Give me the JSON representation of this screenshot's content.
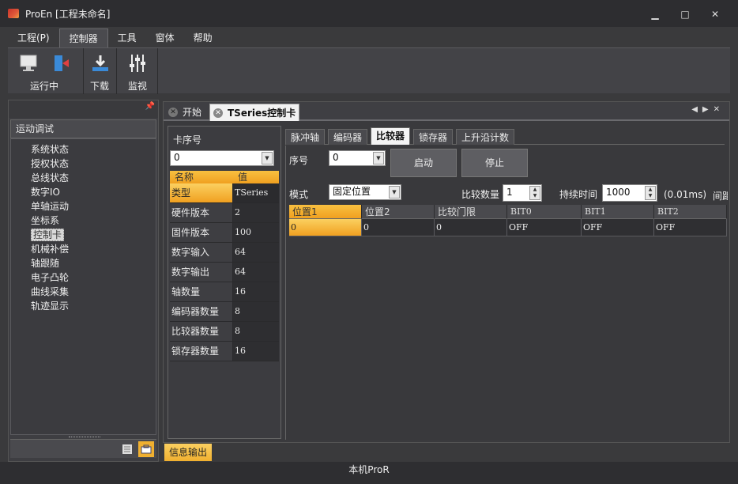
{
  "window": {
    "title": "ProEn [工程未命名]"
  },
  "menu": {
    "items": [
      "工程(P)",
      "控制器",
      "工具",
      "窗体",
      "帮助"
    ]
  },
  "ribbon": {
    "run_label": "运行中",
    "download_label": "下载",
    "monitor_label": "监视"
  },
  "left_panel": {
    "title": "运动调试",
    "items": [
      "系统状态",
      "授权状态",
      "总线状态",
      "数字IO",
      "单轴运动",
      "坐标系",
      "控制卡",
      "机械补偿",
      "轴跟随",
      "电子凸轮",
      "曲线采集",
      "轨迹显示"
    ],
    "selected": "控制卡"
  },
  "doc_tabs": {
    "start": "开始",
    "card": "TSeries控制卡"
  },
  "card": {
    "label": "卡序号",
    "index_value": "0",
    "head_name": "名称",
    "head_value": "值",
    "rows": [
      {
        "k": "类型",
        "v": "TSeries"
      },
      {
        "k": "硬件版本",
        "v": "2"
      },
      {
        "k": "固件版本",
        "v": "100"
      },
      {
        "k": "数字输入",
        "v": "64"
      },
      {
        "k": "数字输出",
        "v": "64"
      },
      {
        "k": "轴数量",
        "v": "16"
      },
      {
        "k": "编码器数量",
        "v": "8"
      },
      {
        "k": "比较器数量",
        "v": "8"
      },
      {
        "k": "锁存器数量",
        "v": "16"
      }
    ]
  },
  "sub_tabs": [
    "脉冲轴",
    "编码器",
    "比较器",
    "锁存器",
    "上升沿计数"
  ],
  "comparator": {
    "index_label": "序号",
    "index_value": "0",
    "start_button": "启动",
    "stop_button": "停止",
    "mode_label": "模式",
    "mode_value": "固定位置",
    "count_label": "比较数量",
    "count_value": "1",
    "duration_label": "持续时间",
    "duration_value": "1000",
    "unit_label": "(0.01ms)",
    "interval_label": "间距",
    "columns": [
      "位置1",
      "位置2",
      "比较门限",
      "BIT0",
      "BIT1",
      "BIT2"
    ],
    "row": [
      "0",
      "0",
      "0",
      "OFF",
      "OFF",
      "OFF"
    ]
  },
  "output_tab": "信息输出",
  "status": "本机ProR"
}
